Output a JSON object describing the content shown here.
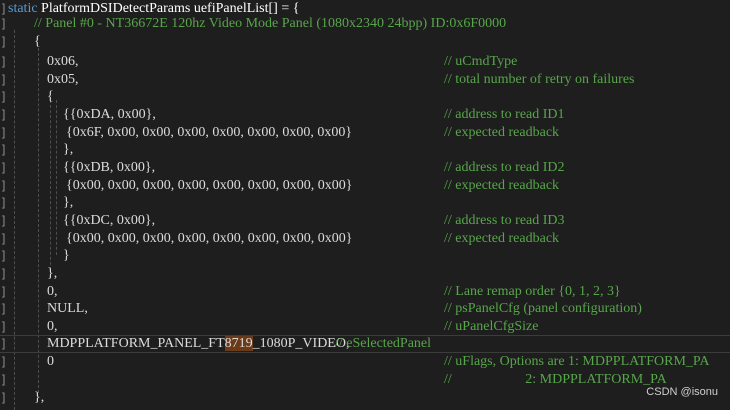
{
  "gutter_marker": "]",
  "lines": {
    "l0": {
      "kw": "static",
      "code": " PlatformDSIDetectParams uefiPanelList[] = {"
    },
    "l1": {
      "code": "// Panel #0 - NT36672E 120hz Video Mode Panel (1080x2340 24bpp) ID:0x6F0000"
    },
    "l2": {
      "code": "{"
    },
    "l3": {
      "code": "0x06,",
      "comment": "// uCmdType"
    },
    "l4": {
      "code": "0x05,",
      "comment": "// total number of retry on failures"
    },
    "l5": {
      "code": "{"
    },
    "l6": {
      "code": "{{0xDA, 0x00},",
      "comment": "// address to read ID1"
    },
    "l7": {
      "code": "{0x6F, 0x00, 0x00, 0x00, 0x00, 0x00, 0x00, 0x00}",
      "comment": "// expected readback"
    },
    "l8": {
      "code": "},"
    },
    "l9": {
      "code": "{{0xDB, 0x00},",
      "comment": "// address to read ID2"
    },
    "l10": {
      "code": "{0x00, 0x00, 0x00, 0x00, 0x00, 0x00, 0x00, 0x00}",
      "comment": "// expected readback"
    },
    "l11": {
      "code": "},"
    },
    "l12": {
      "code": "{{0xDC, 0x00},",
      "comment": "// address to read ID3"
    },
    "l13": {
      "code": "{0x00, 0x00, 0x00, 0x00, 0x00, 0x00, 0x00, 0x00}",
      "comment": "// expected readback"
    },
    "l14": {
      "code": "}"
    },
    "l15": {
      "code": "},"
    },
    "l16": {
      "code": "0,",
      "comment": "// Lane remap order {0, 1, 2, 3}"
    },
    "l17": {
      "code": "NULL,",
      "comment": "// psPanelCfg (panel configuration)"
    },
    "l18": {
      "code": "0,",
      "comment": "// uPanelCfgSize"
    },
    "l19": {
      "code_a": "MDPPLATFORM_PANEL_FT",
      "highlight": "8719",
      "code_b": "_1080P_VIDEO,",
      "comment": "// eSelectedPanel"
    },
    "l20": {
      "code": "0",
      "comment": "// uFlags, Options are 1: MDPPLATFORM_PA"
    },
    "l21": {
      "comment": "//                     2: MDPPLATFORM_PA"
    },
    "l22": {
      "code": "},"
    }
  },
  "watermark": "CSDN @isonu",
  "colors": {
    "background": "#1e1e1e",
    "text": "#dcdcdc",
    "keyword": "#569cd6",
    "comment": "#57a64a",
    "search_highlight": "#6b3a18"
  }
}
